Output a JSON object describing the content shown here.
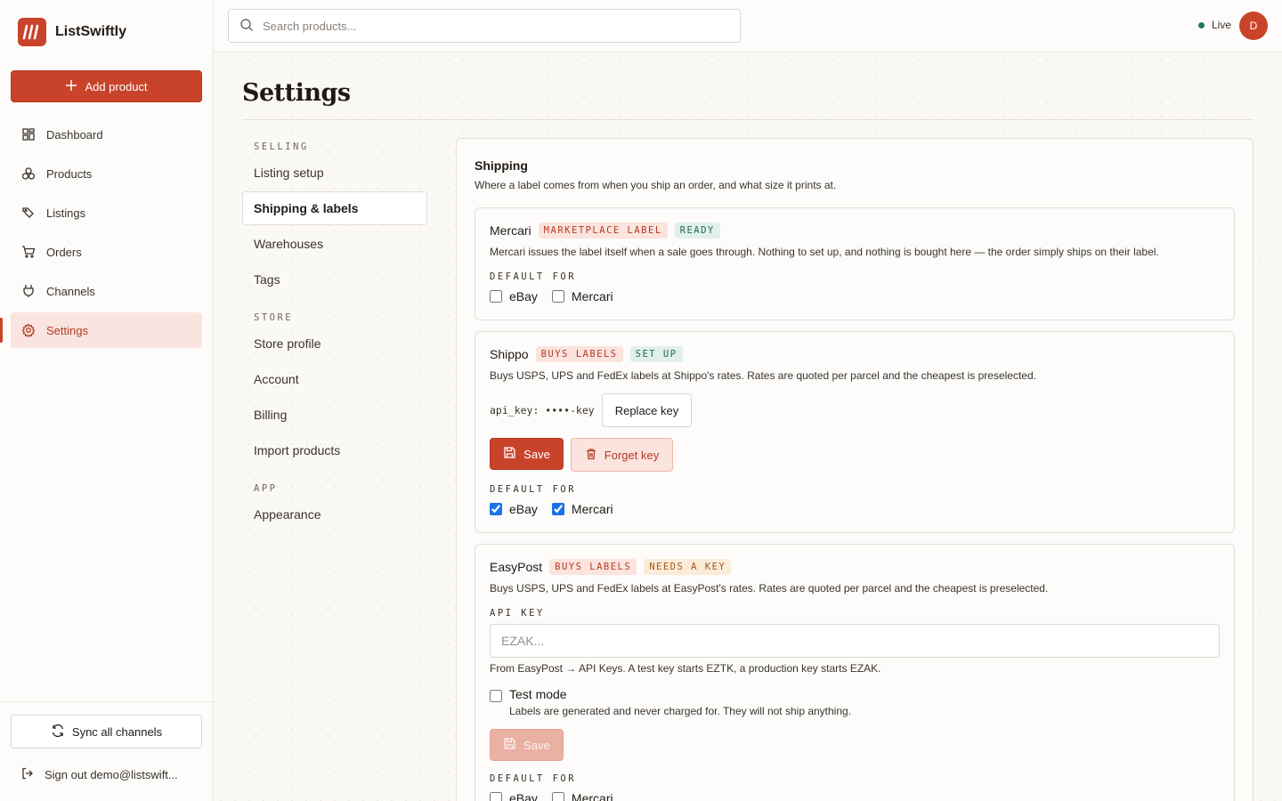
{
  "brand": {
    "name": "ListSwiftly"
  },
  "sidebar": {
    "add_label": "Add product",
    "items": [
      {
        "label": "Dashboard",
        "icon": "dashboard-icon"
      },
      {
        "label": "Products",
        "icon": "products-icon"
      },
      {
        "label": "Listings",
        "icon": "tag-icon"
      },
      {
        "label": "Orders",
        "icon": "cart-icon"
      },
      {
        "label": "Channels",
        "icon": "plug-icon"
      },
      {
        "label": "Settings",
        "icon": "gear-icon",
        "active": true
      }
    ],
    "sync_label": "Sync all channels",
    "signout_label": "Sign out demo@listswift..."
  },
  "topbar": {
    "search_placeholder": "Search products...",
    "status_label": "Live",
    "status_color": "#1f7a5a",
    "avatar_initial": "D"
  },
  "page": {
    "title": "Settings"
  },
  "subnav": {
    "groups": [
      {
        "label": "SELLING",
        "items": [
          "Listing setup",
          "Shipping & labels",
          "Warehouses",
          "Tags"
        ]
      },
      {
        "label": "STORE",
        "items": [
          "Store profile",
          "Account",
          "Billing",
          "Import products"
        ]
      },
      {
        "label": "APP",
        "items": [
          "Appearance"
        ]
      }
    ],
    "active": "Shipping & labels"
  },
  "shipping": {
    "title": "Shipping",
    "description": "Where a label comes from when you ship an order, and what size it prints at.",
    "default_for_label": "DEFAULT FOR",
    "providers": {
      "mercari": {
        "name": "Mercari",
        "tags": [
          "MARKETPLACE LABEL",
          "READY"
        ],
        "description": "Mercari issues the label itself when a sale goes through. Nothing to set up, and nothing is bought here — the order simply ships on their label.",
        "defaults": [
          {
            "label": "eBay",
            "checked": false
          },
          {
            "label": "Mercari",
            "checked": false
          }
        ]
      },
      "shippo": {
        "name": "Shippo",
        "tags": [
          "BUYS LABELS",
          "SET UP"
        ],
        "description": "Buys USPS, UPS and FedEx labels at Shippo's rates. Rates are quoted per parcel and the cheapest is preselected.",
        "api_key_display": "api_key: ••••-key",
        "replace_label": "Replace key",
        "save_label": "Save",
        "forget_label": "Forget key",
        "defaults": [
          {
            "label": "eBay",
            "checked": true
          },
          {
            "label": "Mercari",
            "checked": true
          }
        ]
      },
      "easypost": {
        "name": "EasyPost",
        "tags": [
          "BUYS LABELS",
          "NEEDS A KEY"
        ],
        "description": "Buys USPS, UPS and FedEx labels at EasyPost's rates. Rates are quoted per parcel and the cheapest is preselected.",
        "api_key_label": "API KEY",
        "api_key_placeholder": "EZAK...",
        "api_key_value": "",
        "help": "From EasyPost → API Keys. A test key starts EZTK, a production key starts EZAK.",
        "test_mode_label": "Test mode",
        "test_mode_sub": "Labels are generated and never charged for. They will not ship anything.",
        "test_mode_checked": false,
        "save_label": "Save",
        "defaults": [
          {
            "label": "eBay",
            "checked": false
          },
          {
            "label": "Mercari",
            "checked": false
          }
        ]
      }
    }
  },
  "colors": {
    "accent": "#c8432a",
    "accent_soft": "#fae4e0"
  }
}
